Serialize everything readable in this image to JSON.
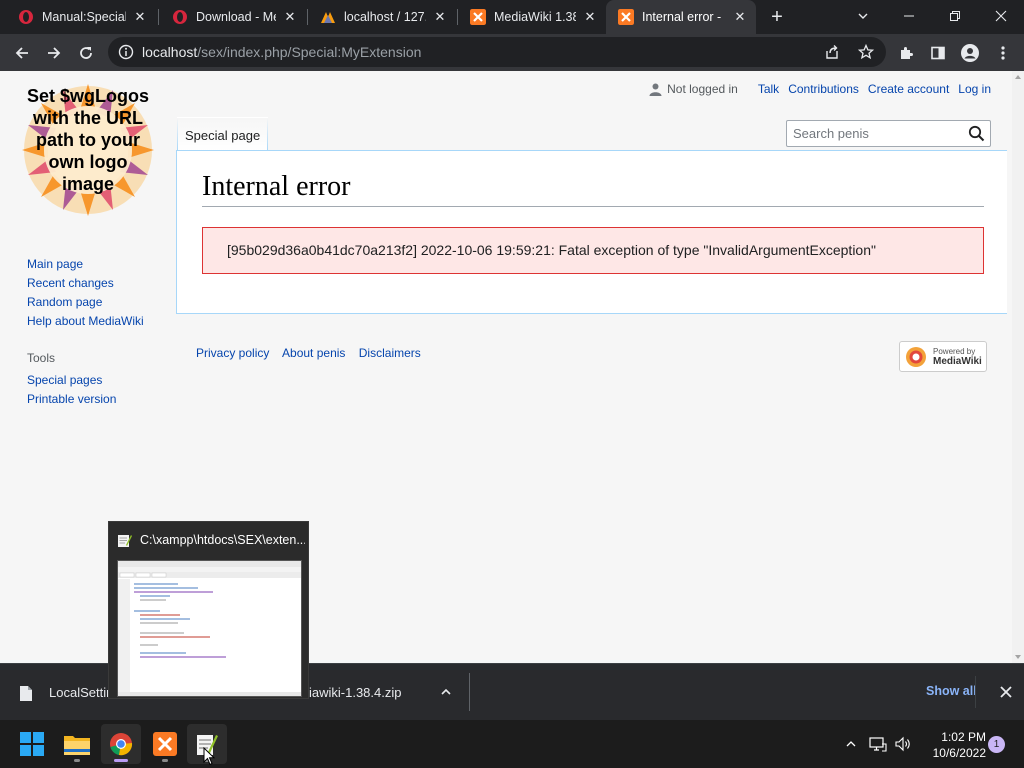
{
  "browser": {
    "tabs": [
      {
        "title": "Manual:Special p",
        "favicon": "opera-icon",
        "active": false
      },
      {
        "title": "Download - Me",
        "favicon": "opera-icon",
        "active": false
      },
      {
        "title": "localhost / 127.0",
        "favicon": "phpmyadmin-icon",
        "active": false
      },
      {
        "title": "MediaWiki 1.38.",
        "favicon": "xampp-icon",
        "active": false
      },
      {
        "title": "Internal error - ",
        "favicon": "xampp-icon",
        "active": true
      }
    ],
    "address": {
      "host": "localhost",
      "path": "/sex/index.php/Special:MyExtension"
    }
  },
  "wiki": {
    "logo_text": "Set $wgLogos with the URL path to your own logo image",
    "navigation": [
      "Main page",
      "Recent changes",
      "Random page",
      "Help about MediaWiki"
    ],
    "tools_heading": "Tools",
    "tools": [
      "Special pages",
      "Printable version"
    ],
    "personal": {
      "not_logged_in": "Not logged in",
      "links": [
        "Talk",
        "Contributions",
        "Create account",
        "Log in"
      ]
    },
    "content_tab": "Special page",
    "search_placeholder": "Search penis",
    "heading": "Internal error",
    "error_message": "[95b029d36a0b41dc70a213f2] 2022-10-06 19:59:21: Fatal exception of type \"InvalidArgumentException\"",
    "footer_links": [
      "Privacy policy",
      "About penis",
      "Disclaimers"
    ],
    "powered_by_line1": "Powered by",
    "powered_by_line2": "MediaWiki"
  },
  "taskbar_preview": {
    "title": "C:\\xampp\\htdocs\\SEX\\exten..."
  },
  "downloads": {
    "item1": "LocalSettir",
    "item2": "iawiki-1.38.4.zip",
    "show_all": "Show all"
  },
  "system_tray": {
    "time": "1:02 PM",
    "date": "10/6/2022",
    "notification_count": "1"
  },
  "colors": {
    "accent": "#0645ad",
    "error_bg": "#fee7e6",
    "error_border": "#dd3333"
  }
}
